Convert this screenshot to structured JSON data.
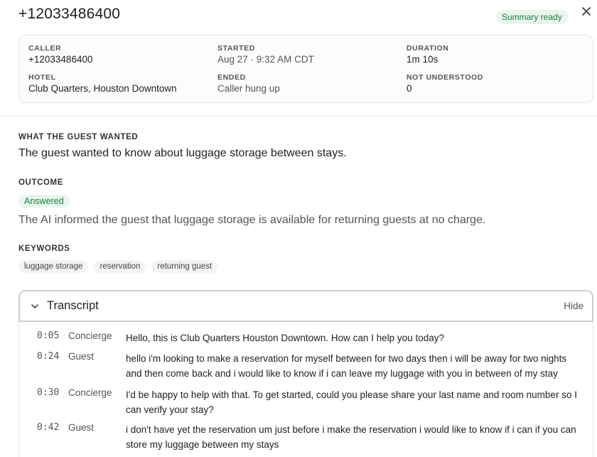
{
  "header": {
    "title": "+12033486400",
    "status_badge": "Summary ready"
  },
  "info": {
    "caller_label": "CALLER",
    "caller_value": "+12033486400",
    "hotel_label": "HOTEL",
    "hotel_value": "Club Quarters, Houston Downtown",
    "started_label": "STARTED",
    "started_value": "Aug 27 · 9:32 AM CDT",
    "ended_label": "ENDED",
    "ended_value": "Caller hung up",
    "duration_label": "DURATION",
    "duration_value": "1m 10s",
    "not_understood_label": "NOT UNDERSTOOD",
    "not_understood_value": "0"
  },
  "wanted": {
    "label": "What the guest wanted",
    "text": "The guest wanted to know about luggage storage between stays."
  },
  "outcome": {
    "label": "Outcome",
    "badge": "Answered",
    "text": "The AI informed the guest that luggage storage is available for returning guests at no charge."
  },
  "keywords": {
    "label": "Keywords",
    "items": [
      "luggage storage",
      "reservation",
      "returning guest"
    ]
  },
  "transcript": {
    "title": "Transcript",
    "hide_label": "Hide",
    "lines": [
      {
        "time": "0:05",
        "speaker": "Concierge",
        "text": "Hello, this is Club Quarters Houston Downtown. How can I help you today?"
      },
      {
        "time": "0:24",
        "speaker": "Guest",
        "text": "hello i'm looking to make a reservation for myself between for two days then i will be away for two nights and then come back and i would like to know if i can leave my luggage with you in between of my stay"
      },
      {
        "time": "0:30",
        "speaker": "Concierge",
        "text": "I'd be happy to help with that. To get started, could you please share your last name and room number so I can verify your stay?"
      },
      {
        "time": "0:42",
        "speaker": "Guest",
        "text": "i don't have yet the reservation um just before i make the reservation i would like to know if i can if you can store my luggage between my stays"
      }
    ]
  }
}
